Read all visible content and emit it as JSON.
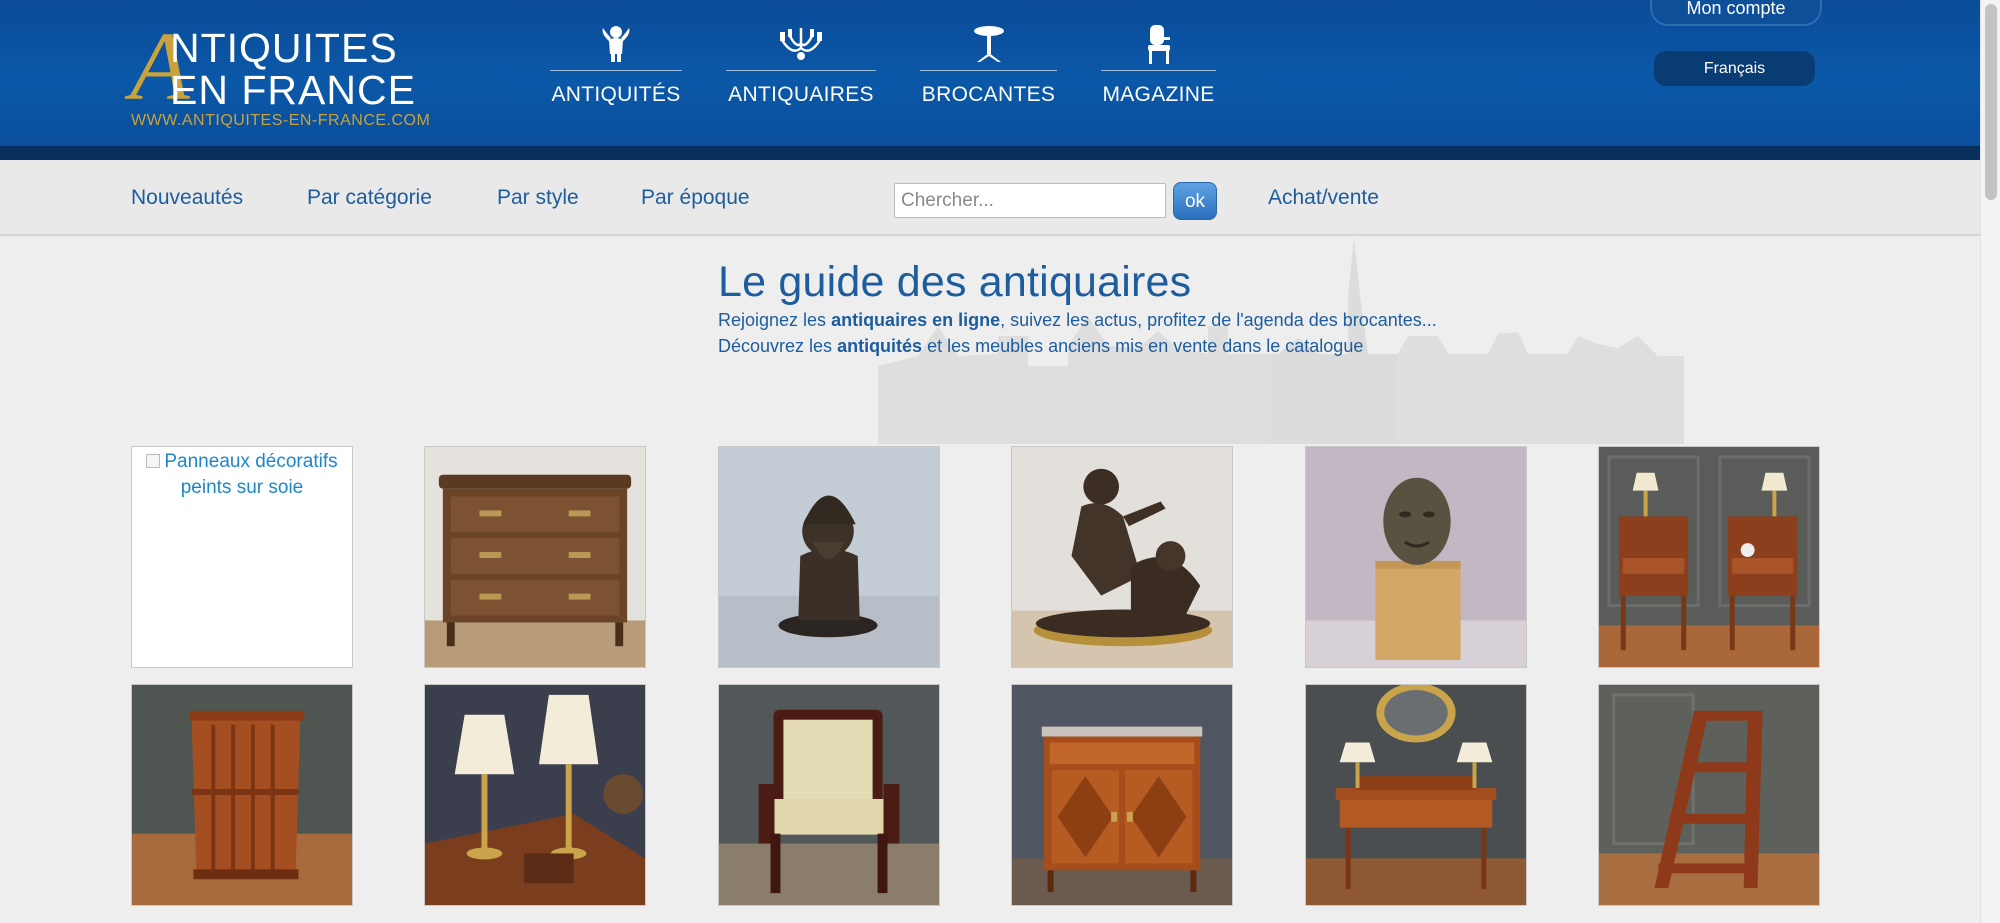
{
  "header": {
    "logo": {
      "letter": "A",
      "line1": "NTIQUITES",
      "line2": "EN FRANCE",
      "url": "WWW.ANTIQUITES-EN-FRANCE.COM"
    },
    "nav": [
      {
        "label": "ANTIQUITÉS",
        "icon": "cherub-icon"
      },
      {
        "label": "ANTIQUAIRES",
        "icon": "chandelier-icon"
      },
      {
        "label": "BROCANTES",
        "icon": "pedestal-table-icon"
      },
      {
        "label": "MAGAZINE",
        "icon": "chair-icon"
      }
    ],
    "account_label": "Mon compte",
    "language_label": "Français"
  },
  "subnav": {
    "links": [
      "Nouveautés",
      "Par catégorie",
      "Par style",
      "Par époque"
    ],
    "search_placeholder": "Chercher...",
    "search_button": "ok",
    "buy_sell": "Achat/vente"
  },
  "hero": {
    "title": "Le guide des antiquaires",
    "line1": {
      "pre": "Rejoignez les ",
      "bold": "antiquaires en ligne",
      "post": ", suivez les actus, profitez de l'agenda des brocantes..."
    },
    "line2": {
      "pre": "Découvrez les ",
      "bold": "antiquités",
      "post": " et les meubles anciens mis en vente dans le catalogue"
    }
  },
  "products": {
    "broken_alt": "Panneaux décoratifs peints sur soie",
    "items": [
      "broken-image",
      "commode-chest-image",
      "bronze-gnome-statuette-image",
      "bronze-putti-sculpture-image",
      "bronze-head-sculpture-image",
      "pair-bedside-tables-image",
      "revolving-bookcase-image",
      "pair-brass-lamps-image",
      "armchair-image",
      "marquetry-cabinet-image",
      "dressing-table-image",
      "library-step-ladder-image"
    ]
  },
  "colors": {
    "header_blue": "#0b58a8",
    "gold": "#c9a23c",
    "link_blue": "#1d5d9d"
  }
}
